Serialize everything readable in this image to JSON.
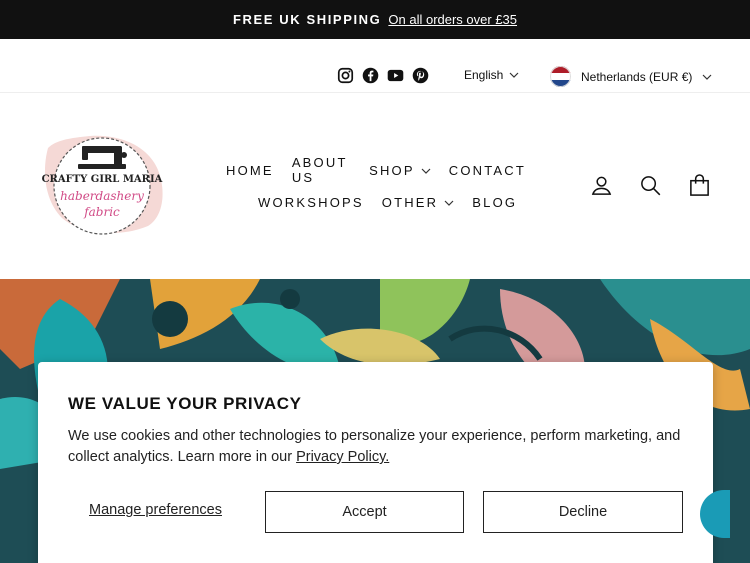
{
  "announcement": {
    "bold": "FREE UK SHIPPING",
    "link": "On all orders over £35"
  },
  "utility": {
    "social": [
      "instagram-icon",
      "facebook-icon",
      "youtube-icon",
      "pinterest-icon"
    ],
    "language": "English",
    "country": "Netherlands (EUR €)"
  },
  "logo": {
    "line1": "CRAFTY GIRL MARIA",
    "line2": "haberdashery",
    "line3": "fabric"
  },
  "nav": {
    "row1": [
      {
        "label": "HOME",
        "dropdown": false
      },
      {
        "label": "ABOUT US",
        "dropdown": false
      },
      {
        "label": "SHOP",
        "dropdown": true
      },
      {
        "label": "CONTACT",
        "dropdown": false
      }
    ],
    "row2": [
      {
        "label": "WORKSHOPS",
        "dropdown": false
      },
      {
        "label": "OTHER",
        "dropdown": true
      },
      {
        "label": "BLOG",
        "dropdown": false
      }
    ]
  },
  "header_icons": [
    "account-icon",
    "search-icon",
    "cart-icon"
  ],
  "cookie": {
    "title": "WE VALUE YOUR PRIVACY",
    "text": "We use cookies and other technologies to personalize your experience, perform marketing, and collect analytics. Learn more in our ",
    "policy_link": "Privacy Policy.",
    "manage": "Manage preferences",
    "accept": "Accept",
    "decline": "Decline"
  }
}
